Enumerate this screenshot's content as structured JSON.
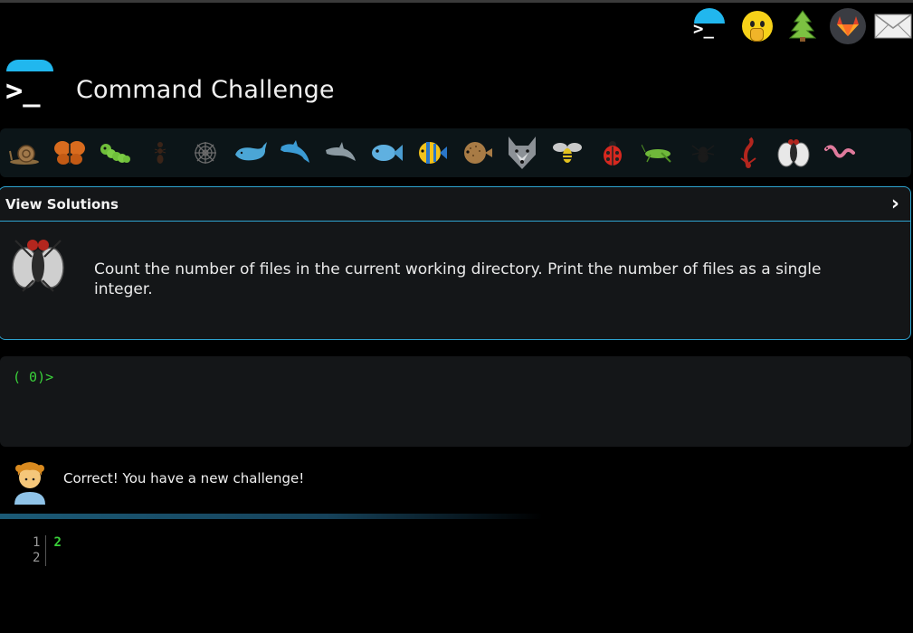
{
  "app": {
    "title": "Command Challenge",
    "logo_icon": "terminal-icon"
  },
  "top_icons": [
    "terminal-icon",
    "shushing-face-icon",
    "evergreen-tree-icon",
    "gitlab-icon",
    "envelope-icon"
  ],
  "creatures": [
    "snail",
    "butterfly",
    "caterpillar",
    "ant",
    "spider-web",
    "whale",
    "dolphin",
    "dolphin",
    "fish",
    "tropical-fish",
    "blowfish",
    "wolf",
    "bee",
    "ladybug",
    "cricket",
    "spider",
    "scorpion",
    "fly",
    "worm"
  ],
  "challenge": {
    "view_solutions_label": "View Solutions",
    "chevron": "›",
    "creature_icon": "fly",
    "description": "Count the number of files in the current working directory. Print the number of files as a single integer."
  },
  "terminal": {
    "prompt": "( 0)>"
  },
  "feedback": {
    "avatar_icon": "person-curly-hair",
    "message": "Correct! You have a new challenge!"
  },
  "output": {
    "line_numbers": [
      "1",
      "2"
    ],
    "lines": [
      "2",
      ""
    ]
  },
  "colors": {
    "accent": "#21b7ee",
    "prompt_green": "#3ad13a",
    "panel_border": "#2ea3cf"
  }
}
